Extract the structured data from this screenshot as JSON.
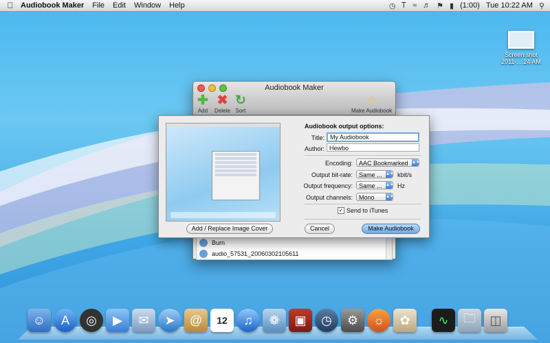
{
  "menubar": {
    "app_name": "Audiobook Maker",
    "menus": [
      "File",
      "Edit",
      "Window",
      "Help"
    ],
    "battery": "(1:00)",
    "clock": "Tue 10:22 AM"
  },
  "desktop": {
    "icon_label_1": "Screen shot",
    "icon_label_2": "2011-....24 AM"
  },
  "main_window": {
    "title": "Audiobook Maker",
    "toolbar": {
      "add": "Add",
      "delete": "Delete",
      "sort": "Sort",
      "make": "Make Audiobook"
    },
    "list_items": [
      "Burn",
      "audio_57531_20060302105611"
    ]
  },
  "sheet": {
    "cover_button": "Add / Replace Image Cover",
    "heading": "Audiobook output options:",
    "title_label": "Title:",
    "title_value": "My Audiobook",
    "author_label": "Author:",
    "author_value": "Hewbo",
    "encoding_label": "Encoding:",
    "encoding_value": "AAC Bookmarked",
    "bitrate_label": "Output bit-rate:",
    "bitrate_value": "Same ...",
    "bitrate_unit": "kbit/s",
    "frequency_label": "Output frequency:",
    "frequency_value": "Same ...",
    "frequency_unit": "Hz",
    "channels_label": "Output channels:",
    "channels_value": "Mono",
    "itunes_label": "Send to iTunes",
    "itunes_checked": true,
    "cancel": "Cancel",
    "make": "Make Audiobook"
  },
  "dock": {
    "icons": [
      "finder-icon",
      "app-store-icon",
      "dashboard-icon",
      "facetime-icon",
      "mail-icon",
      "safari-icon",
      "address-book-icon",
      "ical-icon",
      "itunes-icon",
      "iphoto-icon",
      "photo-booth-icon",
      "time-machine-icon",
      "system-preferences-icon",
      "firefox-icon",
      "audiobook-maker-icon",
      "activity-monitor-icon",
      "documents-folder-icon",
      "trash-icon"
    ],
    "ical_day": "12"
  },
  "colors": {
    "accent": "#3d7fd8",
    "desktop_blue": "#4ab7f0"
  }
}
